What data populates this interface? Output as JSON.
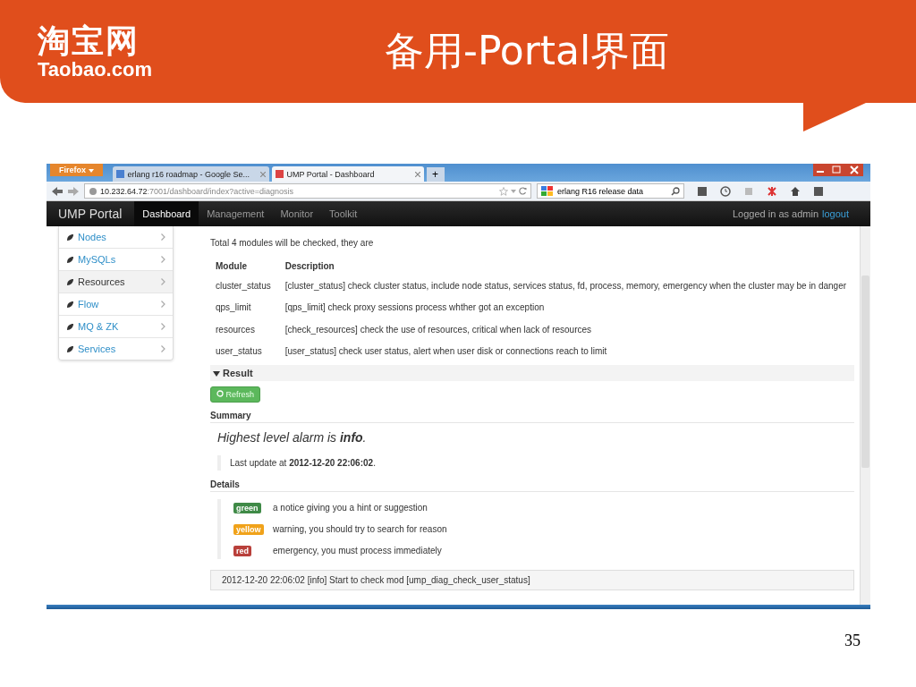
{
  "slide": {
    "logo": {
      "chinese": "淘宝网",
      "latin": "Taobao.com"
    },
    "title": "备用-Portal界面",
    "page_number": "35"
  },
  "browser": {
    "app_button": "Firefox",
    "tabs": [
      {
        "label": "erlang r16 roadmap - Google Se...",
        "selected": false
      },
      {
        "label": "UMP Portal - Dashboard",
        "selected": true
      }
    ],
    "new_tab": "+",
    "address": {
      "host": "10.232.64.72",
      "path": ":7001/dashboard/index?active=diagnosis"
    },
    "search": {
      "value": "erlang R16 release data"
    }
  },
  "navbar": {
    "brand": "UMP Portal",
    "items": [
      {
        "label": "Dashboard",
        "selected": true
      },
      {
        "label": "Management",
        "selected": false
      },
      {
        "label": "Monitor",
        "selected": false
      },
      {
        "label": "Toolkit",
        "selected": false
      }
    ],
    "login_text": "Logged in as admin",
    "logout": "logout"
  },
  "sidebar": {
    "items": [
      {
        "label": "Nodes",
        "selected": false
      },
      {
        "label": "MySQLs",
        "selected": false
      },
      {
        "label": "Resources",
        "selected": true
      },
      {
        "label": "Flow",
        "selected": false
      },
      {
        "label": "MQ & ZK",
        "selected": false
      },
      {
        "label": "Services",
        "selected": false
      }
    ]
  },
  "description": {
    "intro": "Total 4 modules will be checked, they are",
    "columns": [
      "Module",
      "Description"
    ],
    "rows": [
      [
        "cluster_status",
        "[cluster_status] check cluster status, include node status, services status, fd, process, memory, emergency when the cluster may be in danger"
      ],
      [
        "qps_limit",
        "[qps_limit] check proxy sessions process whther got an exception"
      ],
      [
        "resources",
        "[check_resources] check the use of resources, critical when lack of resources"
      ],
      [
        "user_status",
        "[user_status] check user status, alert when user disk or connections reach to limit"
      ]
    ]
  },
  "result": {
    "heading": "Result",
    "refresh": "Refresh",
    "summary_heading": "Summary",
    "alarm": "Highest level alarm is **info**.",
    "last_update": "Last update at **2012-12-20 22:06:02**.",
    "details_heading": "Details",
    "levels": [
      {
        "label": "green",
        "color": "#3f8a47",
        "text": "a notice giving you a hint or suggestion"
      },
      {
        "label": "yellow",
        "color": "#f0a21a",
        "text": "warning, you should try to search for reason"
      },
      {
        "label": "red",
        "color": "#b9403b",
        "text": "emergency, you must process immediately"
      }
    ],
    "log": "2012-12-20 22:06:02 [info] Start to check mod [ump_diag_check_user_status]"
  }
}
